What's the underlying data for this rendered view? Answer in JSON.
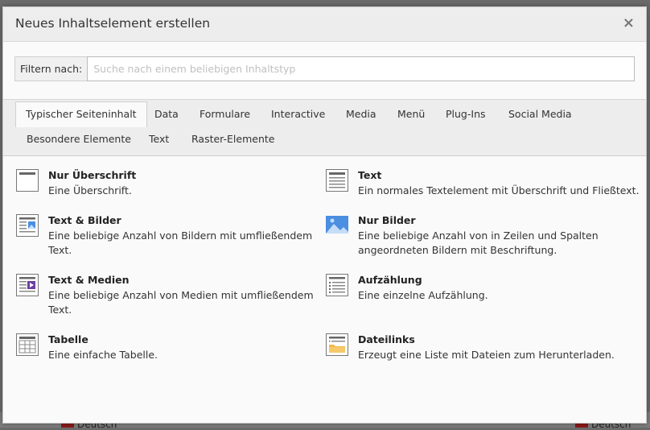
{
  "modal": {
    "title": "Neues Inhaltselement erstellen",
    "close_symbol": "×"
  },
  "filter": {
    "label": "Filtern nach:",
    "placeholder": "Suche nach einem beliebigen Inhaltstyp",
    "value": ""
  },
  "tabs": [
    {
      "label": "Typischer Seiteninhalt",
      "active": true
    },
    {
      "label": "Data"
    },
    {
      "label": "Formulare"
    },
    {
      "label": "Interactive"
    },
    {
      "label": "Media"
    },
    {
      "label": "Menü"
    },
    {
      "label": "Plug-Ins"
    },
    {
      "label": "Social Media"
    },
    {
      "label": "Besondere Elemente"
    },
    {
      "label": "Text"
    },
    {
      "label": "Raster-Elemente"
    }
  ],
  "elements": [
    {
      "title": "Nur Überschrift",
      "desc_lines": [
        "Eine Überschrift."
      ],
      "icon": "header-icon"
    },
    {
      "title": "Text",
      "desc_lines": [
        "Ein normales Textelement mit Überschrift und Fließtext."
      ],
      "icon": "text-icon"
    },
    {
      "title": "Text & Bilder",
      "desc_lines": [
        "Eine beliebige Anzahl von Bildern mit umfließendem",
        "Text."
      ],
      "icon": "text-images-icon"
    },
    {
      "title": "Nur Bilder",
      "desc_lines": [
        "Eine beliebige Anzahl von in Zeilen und Spalten",
        "angeordneten Bildern mit Beschriftung."
      ],
      "icon": "images-icon"
    },
    {
      "title": "Text & Medien",
      "desc_lines": [
        "Eine beliebige Anzahl von Medien mit umfließendem",
        "Text."
      ],
      "icon": "text-media-icon"
    },
    {
      "title": "Aufzählung",
      "desc_lines": [
        "Eine einzelne Aufzählung."
      ],
      "icon": "bullets-icon"
    },
    {
      "title": "Tabelle",
      "desc_lines": [
        "Eine einfache Tabelle."
      ],
      "icon": "table-icon"
    },
    {
      "title": "Dateilinks",
      "desc_lines": [
        "Erzeugt eine Liste mit Dateien zum Herunterladen."
      ],
      "icon": "filelinks-icon"
    }
  ],
  "background": {
    "left_item": "Deutsch",
    "right_item": "Deutsch"
  },
  "colors": {
    "accent_blue": "#4a8fe0",
    "media_purple": "#6b3fa0",
    "folder_yellow": "#f0b84a"
  }
}
